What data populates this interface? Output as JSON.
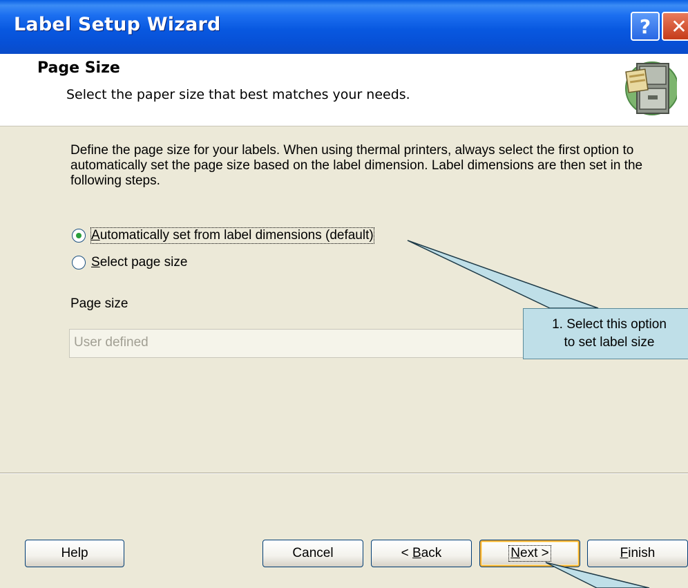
{
  "window": {
    "title": "Label Setup Wizard"
  },
  "titlebar_buttons": {
    "help": "?",
    "close": "✕"
  },
  "header": {
    "title": "Page Size",
    "subtitle": "Select the paper size that best matches your needs.",
    "icon": "file-cabinet-icon"
  },
  "description": "Define the page size for your labels. When using thermal printers, always select the first option to automatically set the page size based on the label dimension. Label dimensions are then set in the following steps.",
  "options": [
    {
      "label_pre": "",
      "label_access": "A",
      "label_post": "utomatically set from label dimensions (default)",
      "selected": true
    },
    {
      "label_pre": "",
      "label_access": "S",
      "label_post": "elect page size",
      "selected": false
    }
  ],
  "page_size": {
    "label": "Page size",
    "value": "User defined"
  },
  "buttons": {
    "help": "Help",
    "cancel": "Cancel",
    "back_pre": "< ",
    "back_access": "B",
    "back_post": "ack",
    "next_access": "N",
    "next_post": "ext >",
    "finish_access": "F",
    "finish_post": "inish"
  },
  "callout": {
    "line1": "1. Select this option",
    "line2": "to set label size"
  },
  "colors": {
    "titlebar": "#0A5FE3",
    "dialog_bg": "#ECE9D8",
    "callout_bg": "#BFDFE8",
    "radio_dot": "#2A9F3B"
  }
}
